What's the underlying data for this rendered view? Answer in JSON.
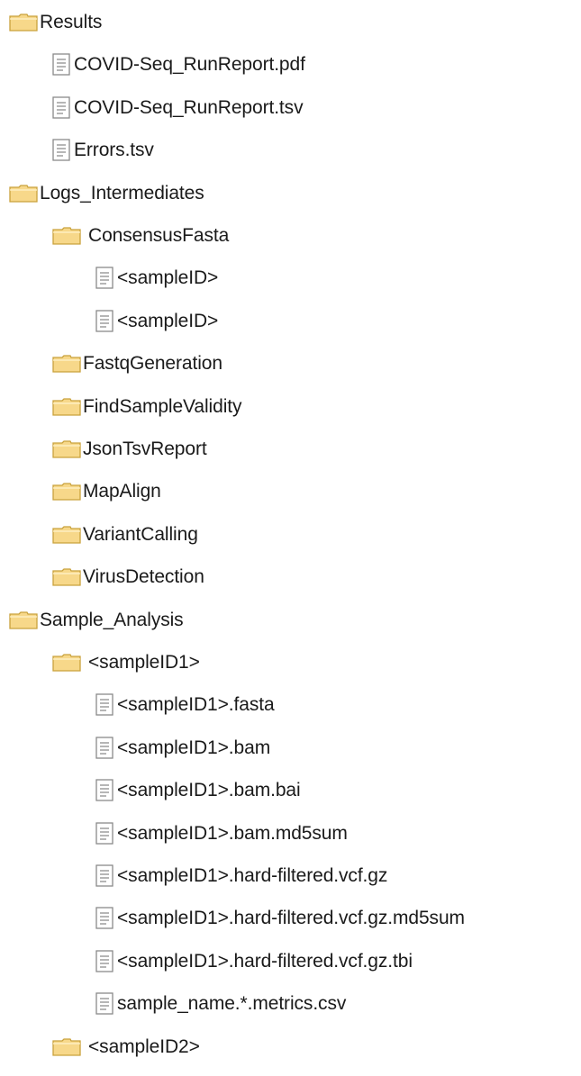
{
  "tree": {
    "nodes": [
      {
        "type": "folder",
        "label": "Results",
        "depth": 0
      },
      {
        "type": "file",
        "label": "COVID-Seq_RunReport.pdf",
        "depth": 1
      },
      {
        "type": "file",
        "label": "COVID-Seq_RunReport.tsv",
        "depth": 1
      },
      {
        "type": "file",
        "label": "Errors.tsv",
        "depth": 1
      },
      {
        "type": "folder",
        "label": "Logs_Intermediates",
        "depth": 0
      },
      {
        "type": "folder",
        "label": "ConsensusFasta",
        "depth": 1,
        "spaced": true
      },
      {
        "type": "file",
        "label": "<sampleID>",
        "depth": 2
      },
      {
        "type": "file",
        "label": "<sampleID>",
        "depth": 2
      },
      {
        "type": "folder",
        "label": "FastqGeneration",
        "depth": 1
      },
      {
        "type": "folder",
        "label": "FindSampleValidity",
        "depth": 1
      },
      {
        "type": "folder",
        "label": "JsonTsvReport",
        "depth": 1
      },
      {
        "type": "folder",
        "label": "MapAlign",
        "depth": 1
      },
      {
        "type": "folder",
        "label": "VariantCalling",
        "depth": 1
      },
      {
        "type": "folder",
        "label": "VirusDetection",
        "depth": 1
      },
      {
        "type": "folder",
        "label": "Sample_Analysis",
        "depth": 0
      },
      {
        "type": "folder",
        "label": "<sampleID1>",
        "depth": 1,
        "spaced": true
      },
      {
        "type": "file",
        "label": "<sampleID1>.fasta",
        "depth": 2
      },
      {
        "type": "file",
        "label": "<sampleID1>.bam",
        "depth": 2
      },
      {
        "type": "file",
        "label": "<sampleID1>.bam.bai",
        "depth": 2
      },
      {
        "type": "file",
        "label": "<sampleID1>.bam.md5sum",
        "depth": 2
      },
      {
        "type": "file",
        "label": "<sampleID1>.hard-filtered.vcf.gz",
        "depth": 2
      },
      {
        "type": "file",
        "label": "<sampleID1>.hard-filtered.vcf.gz.md5sum",
        "depth": 2
      },
      {
        "type": "file",
        "label": "<sampleID1>.hard-filtered.vcf.gz.tbi",
        "depth": 2
      },
      {
        "type": "file",
        "label": "sample_name.*.metrics.csv",
        "depth": 2
      },
      {
        "type": "folder",
        "label": "<sampleID2>",
        "depth": 1,
        "spaced": true
      }
    ]
  },
  "colors": {
    "folder_fill": "#f7d88a",
    "folder_stroke": "#c9a23c",
    "file_fill": "#ffffff",
    "file_stroke": "#8a8a8a",
    "text": "#1a1a1a"
  }
}
